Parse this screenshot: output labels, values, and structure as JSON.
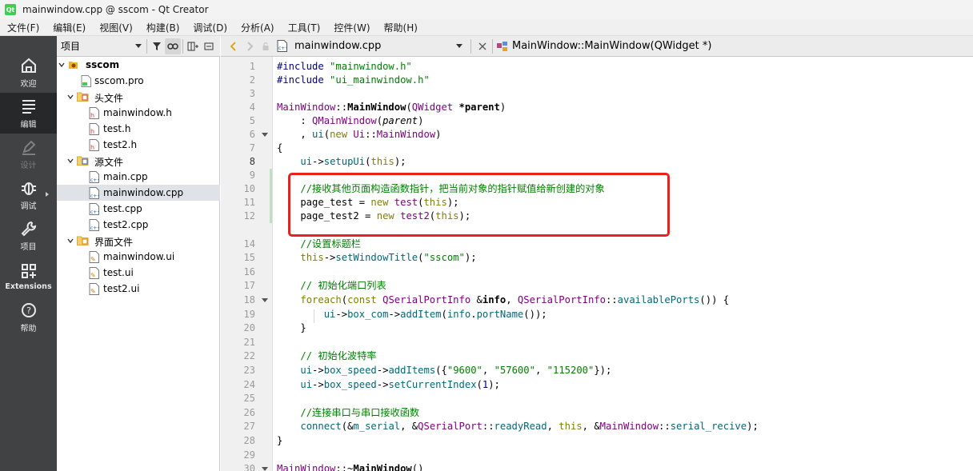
{
  "window": {
    "title": "mainwindow.cpp @ sscom - Qt Creator",
    "app_icon_text": "Qt"
  },
  "menubar": [
    "文件(F)",
    "编辑(E)",
    "视图(V)",
    "构建(B)",
    "调试(D)",
    "分析(A)",
    "工具(T)",
    "控件(W)",
    "帮助(H)"
  ],
  "modes": [
    {
      "label": "欢迎",
      "icon": "home-icon"
    },
    {
      "label": "编辑",
      "icon": "edit-document-icon",
      "active": true
    },
    {
      "label": "设计",
      "icon": "design-pen-icon",
      "disabled": true
    },
    {
      "label": "调试",
      "icon": "debug-bug-icon"
    },
    {
      "label": "项目",
      "icon": "wrench-icon"
    },
    {
      "label": "Extensions",
      "icon": "extensions-grid-icon"
    },
    {
      "label": "帮助",
      "icon": "help-icon"
    }
  ],
  "project_panel": {
    "combo_label": "项目",
    "buttons": [
      "filter-icon",
      "link-icon",
      "split-add-icon",
      "close-panel-icon"
    ]
  },
  "tree": [
    {
      "label": "sscom",
      "depth": 0,
      "expanded": true,
      "icon": "project-icon",
      "bold": true
    },
    {
      "label": "sscom.pro",
      "depth": 1,
      "icon": "pro-file-icon"
    },
    {
      "label": "头文件",
      "depth": 1,
      "expanded": true,
      "icon": "header-folder-icon"
    },
    {
      "label": "mainwindow.h",
      "depth": 2,
      "icon": "h-file-icon"
    },
    {
      "label": "test.h",
      "depth": 2,
      "icon": "h-file-icon"
    },
    {
      "label": "test2.h",
      "depth": 2,
      "icon": "h-file-icon"
    },
    {
      "label": "源文件",
      "depth": 1,
      "expanded": true,
      "icon": "source-folder-icon"
    },
    {
      "label": "main.cpp",
      "depth": 2,
      "icon": "cpp-file-icon"
    },
    {
      "label": "mainwindow.cpp",
      "depth": 2,
      "icon": "cpp-file-icon",
      "selected": true
    },
    {
      "label": "test.cpp",
      "depth": 2,
      "icon": "cpp-file-icon"
    },
    {
      "label": "test2.cpp",
      "depth": 2,
      "icon": "cpp-file-icon"
    },
    {
      "label": "界面文件",
      "depth": 1,
      "expanded": true,
      "icon": "forms-folder-icon"
    },
    {
      "label": "mainwindow.ui",
      "depth": 2,
      "icon": "ui-file-icon"
    },
    {
      "label": "test.ui",
      "depth": 2,
      "icon": "ui-file-icon"
    },
    {
      "label": "test2.ui",
      "depth": 2,
      "icon": "ui-file-icon"
    }
  ],
  "editor_toolbar": {
    "file_name": "mainwindow.cpp",
    "symbol": "MainWindow::MainWindow(QWidget *)"
  },
  "code_lines": [
    {
      "n": "1",
      "segs": [
        [
          "pp",
          "#include "
        ],
        [
          "str",
          "\"mainwindow.h\""
        ]
      ]
    },
    {
      "n": "2",
      "segs": [
        [
          "pp",
          "#include "
        ],
        [
          "str",
          "\"ui_mainwindow.h\""
        ]
      ]
    },
    {
      "n": "3",
      "segs": []
    },
    {
      "n": "4",
      "segs": [
        [
          "typ",
          "MainWindow"
        ],
        [
          "",
          "::"
        ],
        [
          "bold",
          "MainWindow"
        ],
        [
          "",
          "("
        ],
        [
          "typ",
          "QWidget"
        ],
        [
          "",
          " "
        ],
        [
          "ptr",
          "*parent"
        ],
        [
          "",
          ")"
        ]
      ]
    },
    {
      "n": "5",
      "segs": [
        [
          "",
          "    : "
        ],
        [
          "typ",
          "QMainWindow"
        ],
        [
          "",
          "("
        ],
        [
          "it",
          "parent"
        ],
        [
          "",
          ")"
        ]
      ]
    },
    {
      "n": "6",
      "fold": true,
      "segs": [
        [
          "",
          "    , "
        ],
        [
          "fn",
          "ui"
        ],
        [
          "",
          "("
        ],
        [
          "kw",
          "new"
        ],
        [
          "",
          " "
        ],
        [
          "typ",
          "Ui"
        ],
        [
          "",
          "::"
        ],
        [
          "typ",
          "MainWindow"
        ],
        [
          "",
          ")"
        ]
      ]
    },
    {
      "n": "7",
      "segs": [
        [
          "",
          "{"
        ]
      ]
    },
    {
      "n": "8",
      "current": true,
      "segs": [
        [
          "",
          "    "
        ],
        [
          "fn",
          "ui"
        ],
        [
          "",
          "->"
        ],
        [
          "fn",
          "setupUi"
        ],
        [
          "",
          "("
        ],
        [
          "kw",
          "this"
        ],
        [
          "",
          ");"
        ]
      ]
    },
    {
      "n": "9",
      "changed": true,
      "segs": []
    },
    {
      "n": "10",
      "changed": true,
      "segs": [
        [
          "",
          "    "
        ],
        [
          "cmt",
          "//接收其他页面构造函数指针，把当前对象的指针赋值给新创建的对象"
        ]
      ]
    },
    {
      "n": "11",
      "changed": true,
      "segs": [
        [
          "",
          "    page_test = "
        ],
        [
          "kw",
          "new"
        ],
        [
          "",
          " "
        ],
        [
          "typ",
          "test"
        ],
        [
          "",
          "("
        ],
        [
          "kw",
          "this"
        ],
        [
          "",
          ");"
        ]
      ]
    },
    {
      "n": "12",
      "changed": true,
      "segs": [
        [
          "",
          "    page_test2 = "
        ],
        [
          "kw",
          "new"
        ],
        [
          "",
          " "
        ],
        [
          "typ",
          "test2"
        ],
        [
          "",
          "("
        ],
        [
          "kw",
          "this"
        ],
        [
          "",
          ");"
        ]
      ]
    },
    {
      "n": "14",
      "segs": [
        [
          "",
          "    "
        ],
        [
          "cmt",
          "//设置标题栏"
        ]
      ]
    },
    {
      "n": "15",
      "segs": [
        [
          "",
          "    "
        ],
        [
          "kw",
          "this"
        ],
        [
          "",
          "->"
        ],
        [
          "fn",
          "setWindowTitle"
        ],
        [
          "",
          "("
        ],
        [
          "str",
          "\"sscom\""
        ],
        [
          "",
          ");"
        ]
      ]
    },
    {
      "n": "16",
      "segs": []
    },
    {
      "n": "17",
      "segs": [
        [
          "",
          "    "
        ],
        [
          "cmt",
          "// 初始化端口列表"
        ]
      ]
    },
    {
      "n": "18",
      "fold": true,
      "segs": [
        [
          "",
          "    "
        ],
        [
          "kw",
          "foreach"
        ],
        [
          "",
          "("
        ],
        [
          "kw",
          "const"
        ],
        [
          "",
          " "
        ],
        [
          "typ",
          "QSerialPortInfo"
        ],
        [
          "",
          " &"
        ],
        [
          "bold",
          "info"
        ],
        [
          "",
          ", "
        ],
        [
          "typ",
          "QSerialPortInfo"
        ],
        [
          "",
          "::"
        ],
        [
          "fn",
          "availablePorts"
        ],
        [
          "",
          "()) {"
        ]
      ]
    },
    {
      "n": "19",
      "segs": [
        [
          "",
          "        "
        ],
        [
          "fn",
          "ui"
        ],
        [
          "",
          "->"
        ],
        [
          "fn",
          "box_com"
        ],
        [
          "",
          "->"
        ],
        [
          "fn",
          "addItem"
        ],
        [
          "",
          "("
        ],
        [
          "fn",
          "info"
        ],
        [
          "",
          "."
        ],
        [
          "fn",
          "portName"
        ],
        [
          "",
          "());"
        ]
      ]
    },
    {
      "n": "20",
      "segs": [
        [
          "",
          "    }"
        ]
      ]
    },
    {
      "n": "21",
      "segs": []
    },
    {
      "n": "22",
      "segs": [
        [
          "",
          "    "
        ],
        [
          "cmt",
          "// 初始化波特率"
        ]
      ]
    },
    {
      "n": "23",
      "segs": [
        [
          "",
          "    "
        ],
        [
          "fn",
          "ui"
        ],
        [
          "",
          "->"
        ],
        [
          "fn",
          "box_speed"
        ],
        [
          "",
          "->"
        ],
        [
          "fn",
          "addItems"
        ],
        [
          "",
          "({"
        ],
        [
          "str",
          "\"9600\""
        ],
        [
          "",
          ", "
        ],
        [
          "str",
          "\"57600\""
        ],
        [
          "",
          ", "
        ],
        [
          "str",
          "\"115200\""
        ],
        [
          "",
          "});"
        ]
      ]
    },
    {
      "n": "24",
      "segs": [
        [
          "",
          "    "
        ],
        [
          "fn",
          "ui"
        ],
        [
          "",
          "->"
        ],
        [
          "fn",
          "box_speed"
        ],
        [
          "",
          "->"
        ],
        [
          "fn",
          "setCurrentIndex"
        ],
        [
          "",
          "("
        ],
        [
          "num",
          "1"
        ],
        [
          "",
          ");"
        ]
      ]
    },
    {
      "n": "25",
      "segs": []
    },
    {
      "n": "26",
      "segs": [
        [
          "",
          "    "
        ],
        [
          "cmt",
          "//连接串口与串口接收函数"
        ]
      ]
    },
    {
      "n": "27",
      "segs": [
        [
          "",
          "    "
        ],
        [
          "fn",
          "connect"
        ],
        [
          "",
          "(&"
        ],
        [
          "fn",
          "m_serial"
        ],
        [
          "",
          ", &"
        ],
        [
          "typ",
          "QSerialPort"
        ],
        [
          "",
          "::"
        ],
        [
          "fn",
          "readyRead"
        ],
        [
          "",
          ", "
        ],
        [
          "kw",
          "this"
        ],
        [
          "",
          ", &"
        ],
        [
          "typ",
          "MainWindow"
        ],
        [
          "",
          "::"
        ],
        [
          "fn",
          "serial_recive"
        ],
        [
          "",
          ");"
        ]
      ]
    },
    {
      "n": "28",
      "segs": [
        [
          "",
          "}"
        ]
      ]
    },
    {
      "n": "29",
      "segs": []
    },
    {
      "n": "30",
      "fold": true,
      "segs": [
        [
          "typ",
          "MainWindow"
        ],
        [
          "",
          "::~"
        ],
        [
          "bold",
          "MainWindow"
        ],
        [
          "",
          "()"
        ]
      ]
    }
  ],
  "highlight": {
    "color": "#e8211c"
  }
}
